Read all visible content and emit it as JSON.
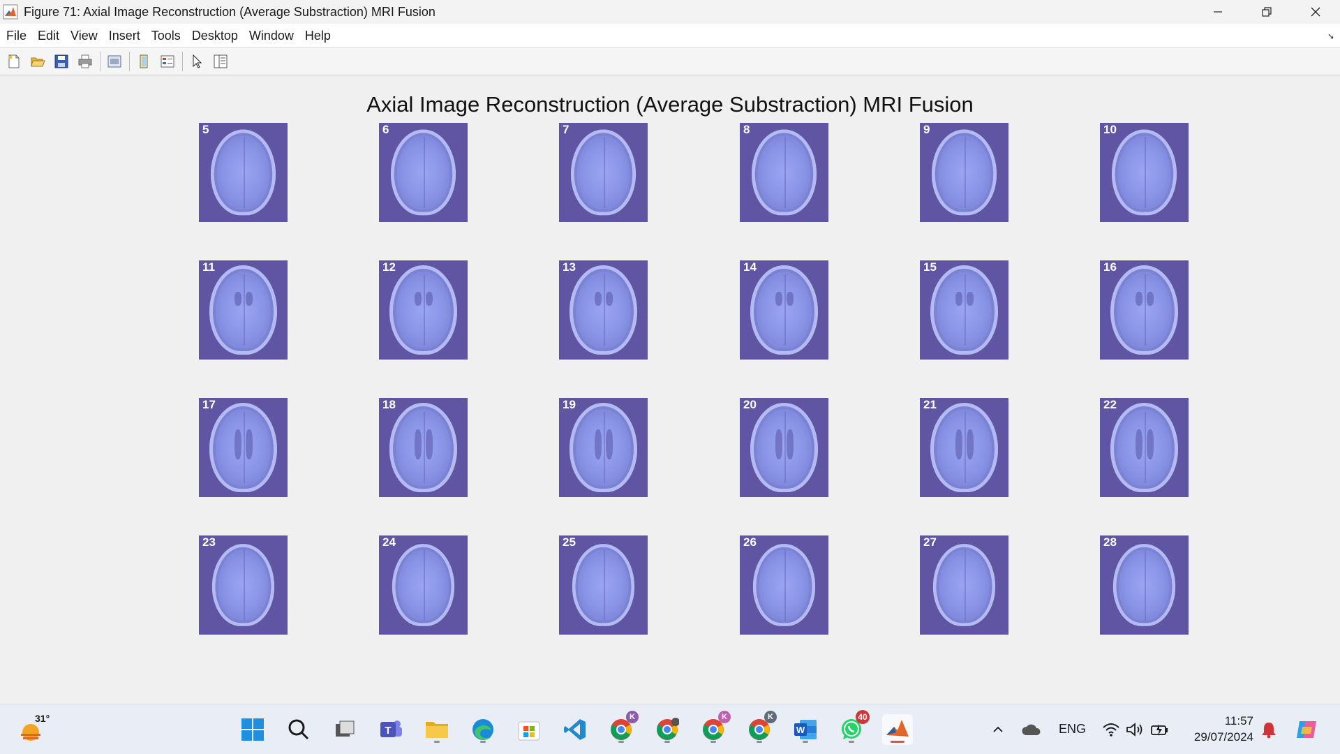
{
  "window": {
    "title": "Figure 71: Axial Image Reconstruction (Average Substraction) MRI Fusion",
    "icon": "matlab-icon"
  },
  "menu": [
    "File",
    "Edit",
    "View",
    "Insert",
    "Tools",
    "Desktop",
    "Window",
    "Help"
  ],
  "toolbar": [
    "new-figure-icon",
    "open-file-icon",
    "save-icon",
    "print-icon",
    "print-preview-icon",
    "link-plot-icon",
    "insert-legend-icon",
    "edit-plot-arrow-icon",
    "property-inspector-icon"
  ],
  "figure": {
    "title": "Axial Image Reconstruction (Average Substraction) MRI Fusion",
    "slices": [
      "5",
      "6",
      "7",
      "8",
      "9",
      "10",
      "11",
      "12",
      "13",
      "14",
      "15",
      "16",
      "17",
      "18",
      "19",
      "20",
      "21",
      "22",
      "23",
      "24",
      "25",
      "26",
      "27",
      "28"
    ],
    "tile_color": "#5f55a3"
  },
  "taskbar": {
    "weather_temp": "31°",
    "apps": [
      "start-icon",
      "search-icon",
      "task-view-icon",
      "teams-icon",
      "file-explorer-icon",
      "edge-icon",
      "microsoft-store-icon",
      "vscode-icon",
      "chrome-icon",
      "chrome-icon",
      "chrome-icon",
      "chrome-icon",
      "word-icon",
      "whatsapp-icon",
      "matlab-icon"
    ],
    "chrome_profile_letter": "K",
    "whatsapp_badge": "40",
    "language": "ENG",
    "time": "11:57",
    "date": "29/07/2024"
  }
}
